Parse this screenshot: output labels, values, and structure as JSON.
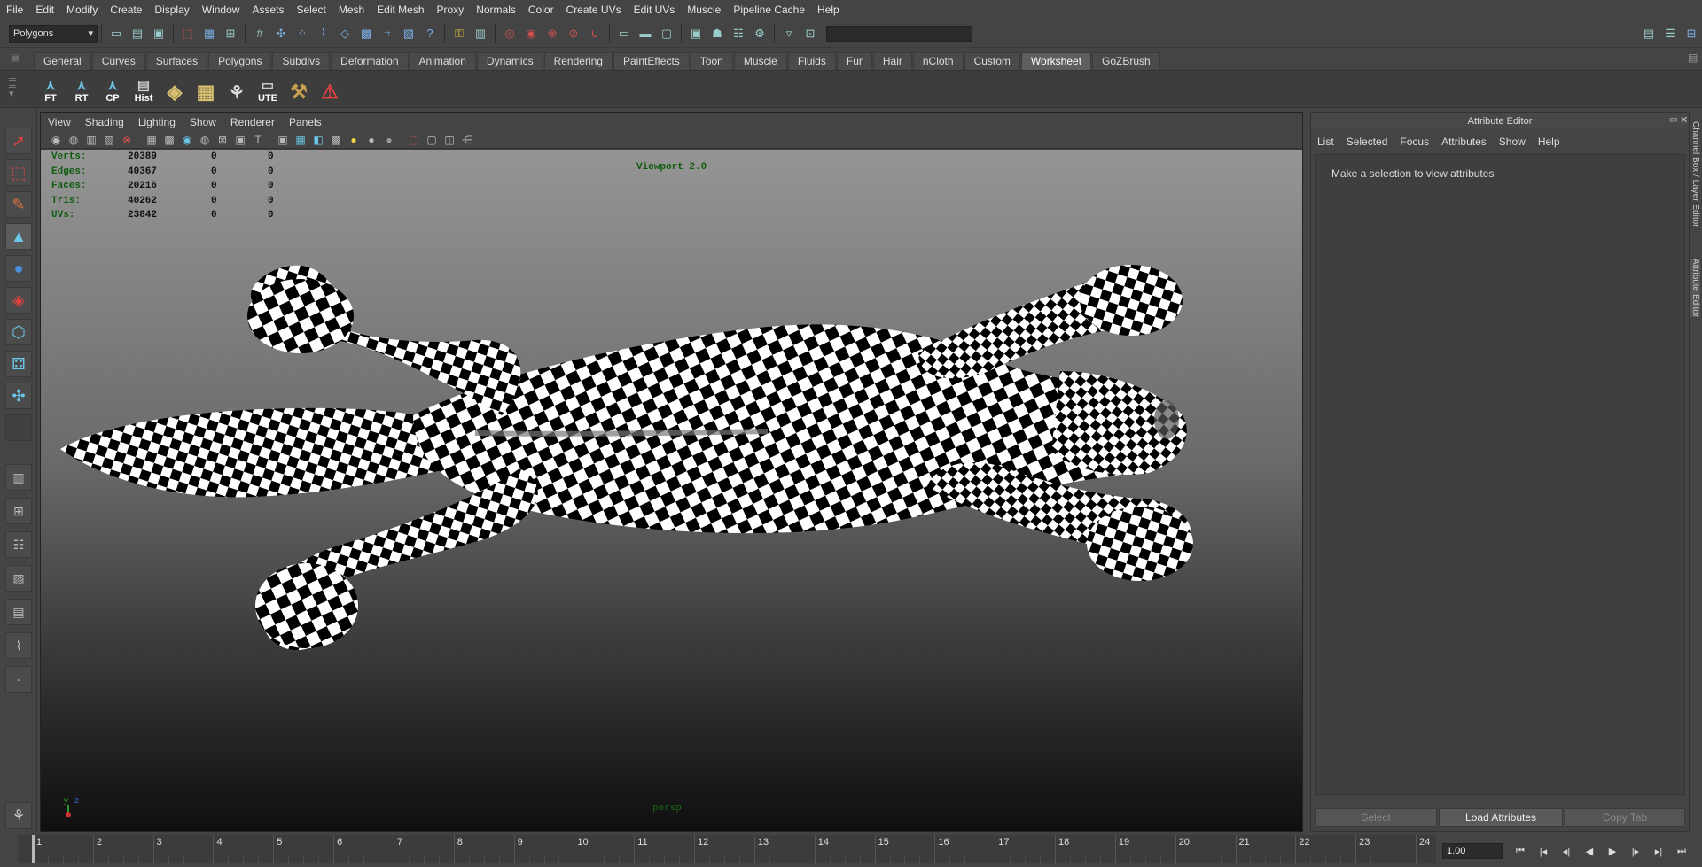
{
  "menubar": {
    "items": [
      "File",
      "Edit",
      "Modify",
      "Create",
      "Display",
      "Window",
      "Assets",
      "Select",
      "Mesh",
      "Edit Mesh",
      "Proxy",
      "Normals",
      "Color",
      "Create UVs",
      "Edit UVs",
      "Muscle",
      "Pipeline Cache",
      "Help"
    ]
  },
  "statusline": {
    "mode": "Polygons"
  },
  "shelf": {
    "tabs": [
      "General",
      "Curves",
      "Surfaces",
      "Polygons",
      "Subdivs",
      "Deformation",
      "Animation",
      "Dynamics",
      "Rendering",
      "PaintEffects",
      "Toon",
      "Muscle",
      "Fluids",
      "Fur",
      "Hair",
      "nCloth",
      "Custom",
      "Worksheet",
      "GoZBrush"
    ],
    "active_tab": "Worksheet",
    "buttons": [
      "FT",
      "RT",
      "CP",
      "Hist",
      "",
      "",
      "",
      "UTE",
      "",
      ""
    ]
  },
  "viewport": {
    "menu": [
      "View",
      "Shading",
      "Lighting",
      "Show",
      "Renderer",
      "Panels"
    ],
    "label": "Viewport 2.0",
    "camera": "persp",
    "axis_x": "x",
    "axis_y": "y",
    "hud": [
      {
        "label": "Verts:",
        "value": "20389",
        "sel": "0",
        "comp": "0"
      },
      {
        "label": "Edges:",
        "value": "40367",
        "sel": "0",
        "comp": "0"
      },
      {
        "label": "Faces:",
        "value": "20216",
        "sel": "0",
        "comp": "0"
      },
      {
        "label": "Tris:",
        "value": "40262",
        "sel": "0",
        "comp": "0"
      },
      {
        "label": "UVs:",
        "value": "23842",
        "sel": "0",
        "comp": "0"
      }
    ]
  },
  "attribute_editor": {
    "title": "Attribute Editor",
    "menu": [
      "List",
      "Selected",
      "Focus",
      "Attributes",
      "Show",
      "Help"
    ],
    "message": "Make a selection to view attributes",
    "buttons": {
      "select": "Select",
      "load": "Load Attributes",
      "copy": "Copy Tab"
    }
  },
  "side_tabs": {
    "channel_box": "Channel Box / Layer Editor",
    "attribute_editor": "Attribute Editor"
  },
  "timeline": {
    "frames": [
      "1",
      "2",
      "3",
      "4",
      "5",
      "6",
      "7",
      "8",
      "9",
      "10",
      "11",
      "12",
      "13",
      "14",
      "15",
      "16",
      "17",
      "18",
      "19",
      "20",
      "21",
      "22",
      "23",
      "24"
    ],
    "current_frame": "1.00"
  },
  "colors": {
    "bg": "#444444",
    "viewport_top": "#959595",
    "viewport_bottom": "#0f0f0f",
    "hud_green": "#0f5c0f"
  }
}
